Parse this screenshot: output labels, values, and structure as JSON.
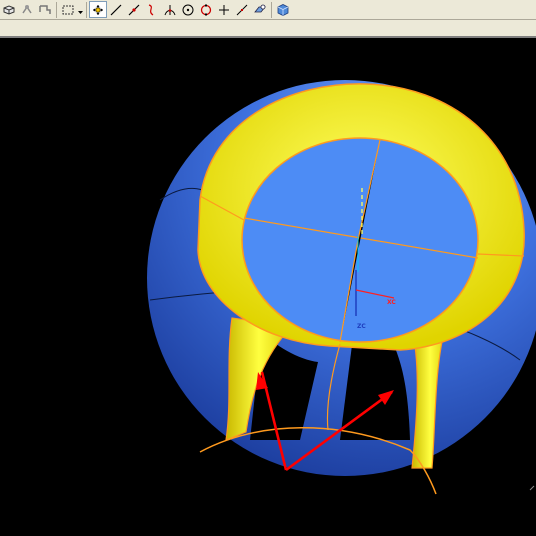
{
  "toolbar": {
    "buttons": [
      {
        "name": "box-view-icon"
      },
      {
        "name": "snap-point-icon"
      },
      {
        "name": "transform-icon"
      },
      {
        "name": "selection-rectangle-icon"
      },
      {
        "name": "move-handles-icon"
      },
      {
        "name": "line-icon"
      },
      {
        "name": "line-point-icon"
      },
      {
        "name": "curve-icon"
      },
      {
        "name": "intersection-icon"
      },
      {
        "name": "circle-center-icon"
      },
      {
        "name": "circle-quadrant-icon"
      },
      {
        "name": "cross-icon"
      },
      {
        "name": "diagonal-line-icon"
      },
      {
        "name": "view-orient-icon"
      },
      {
        "name": "cube-icon"
      }
    ]
  },
  "viewport": {
    "axis_label_zc": "ZC",
    "axis_label_xc": "XC",
    "colors": {
      "background": "#000000",
      "sphere": "#2e5fd6",
      "sphere_highlight": "#6d98f0",
      "ring": "#ffff00",
      "edge": "#ff9a1e",
      "arrow": "#ff0000",
      "inner_face": "#4d8cf5"
    }
  }
}
